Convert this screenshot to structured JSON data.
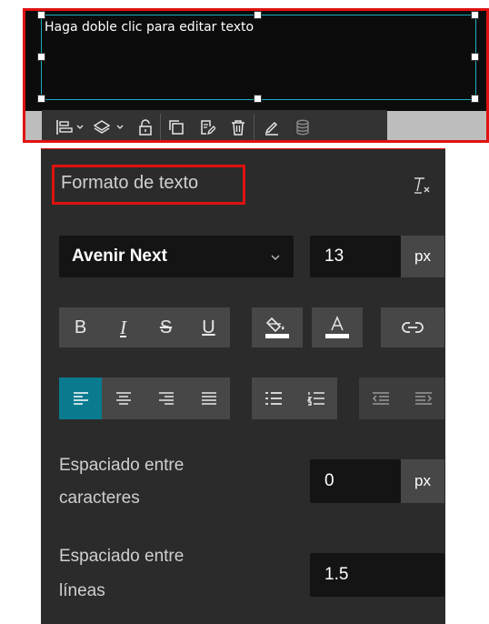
{
  "editor": {
    "placeholder_text": "Haga doble clic para editar texto"
  },
  "toolbar": {
    "items": [
      {
        "icon": "align-icon",
        "has_dropdown": true
      },
      {
        "icon": "layers-icon",
        "has_dropdown": true
      },
      {
        "icon": "unlock-icon"
      },
      {
        "icon": "duplicate-icon"
      },
      {
        "icon": "edit-doc-icon"
      },
      {
        "icon": "delete-icon"
      },
      {
        "icon": "pencil-icon"
      },
      {
        "icon": "database-icon"
      }
    ]
  },
  "panel": {
    "title": "Formato de texto",
    "font_family": "Avenir Next",
    "font_size": "13",
    "font_size_unit": "px",
    "style_buttons": [
      "B",
      "I",
      "S",
      "U"
    ],
    "color_buttons": [
      "fill-color-icon",
      "font-color-icon",
      "link-icon"
    ],
    "align_buttons": [
      "align-left-icon",
      "align-center-icon",
      "align-right-icon",
      "align-justify-icon"
    ],
    "list_buttons": [
      "bullet-list-icon",
      "numbered-list-icon"
    ],
    "indent_buttons": [
      "outdent-icon",
      "indent-icon"
    ],
    "active_align": "align-left",
    "letter_spacing_label_line1": "Espaciado entre",
    "letter_spacing_label_line2": "caracteres",
    "letter_spacing_value": "0",
    "letter_spacing_unit": "px",
    "line_spacing_label_line1": "Espaciado entre",
    "line_spacing_label_line2": "líneas",
    "line_spacing_value": "1.5"
  },
  "colors": {
    "highlight": "#e01111",
    "selection": "#17b0c4",
    "active_button": "#0a7a8f",
    "panel_bg": "#2b2b2b"
  }
}
